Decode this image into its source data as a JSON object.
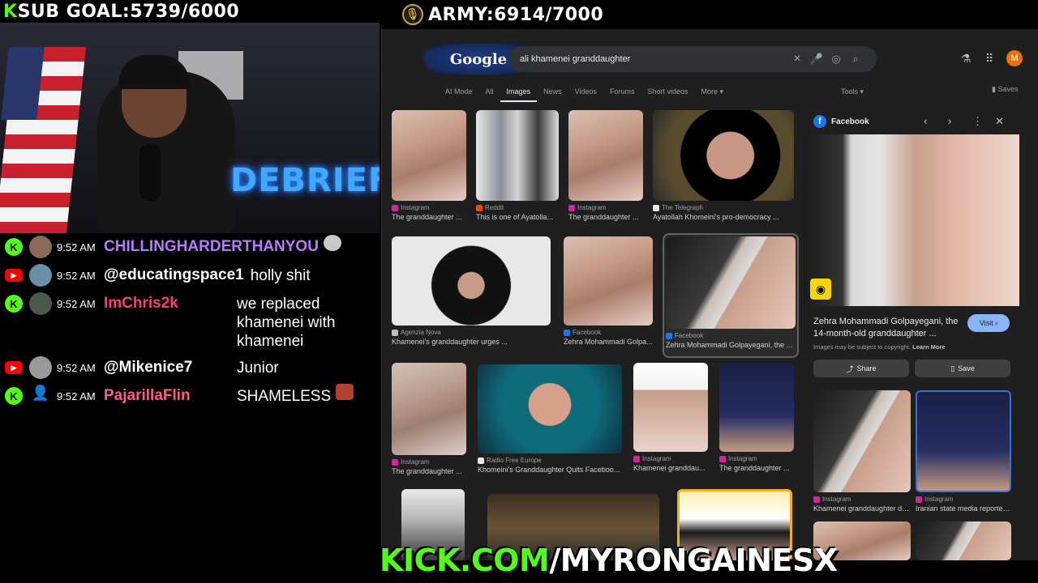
{
  "overlay": {
    "sub_goal_k": "K",
    "sub_goal": "SUB GOAL:5739/6000",
    "army_goal": "ARMY:6914/7000",
    "url_green": "KICK.COM",
    "url_white": "/MYRONGAINESX",
    "accent": "#53fc18"
  },
  "webcam": {
    "sign": "DEBRIEF"
  },
  "chat": [
    {
      "platform": "kick",
      "time": "9:52 AM",
      "user": "CHILLINGHARDERTHANYOU",
      "user_color": "#b77bff",
      "msg": ""
    },
    {
      "platform": "youtube",
      "time": "9:52 AM",
      "user": "@educatingspace1",
      "user_color": "#ffffff",
      "msg": "holly shit"
    },
    {
      "platform": "kick",
      "time": "9:52 AM",
      "user": "ImChris2k",
      "user_color": "#ff3d6e",
      "msg": "we replaced khamenei with khamenei"
    },
    {
      "platform": "youtube",
      "time": "9:52 AM",
      "user": "@Mikenice7",
      "user_color": "#ffffff",
      "msg": "Junior"
    },
    {
      "platform": "kick",
      "time": "9:52 AM",
      "user": "PajarillaFlin",
      "user_color": "#ff5a8a",
      "msg": "SHAMELESS"
    }
  ],
  "google": {
    "logo": "Google",
    "query": "ali khamenei granddaughter",
    "profile_initial": "M",
    "tabs": [
      "AI Mode",
      "All",
      "Images",
      "News",
      "Videos",
      "Forums",
      "Short videos",
      "More"
    ],
    "tools": "Tools",
    "saves": "Saves",
    "results": [
      {
        "source": "Instagram",
        "caption": "The granddaughter ..."
      },
      {
        "source": "Reddit",
        "caption": "This is one of Ayatolla..."
      },
      {
        "source": "Instagram",
        "caption": "The granddaughter ..."
      },
      {
        "source": "The Telegraph",
        "caption": "Ayatollah Khomeini's pro-democracy ..."
      },
      {
        "source": "Agenzia Nova",
        "caption": "Khamenei's granddaughter urges ..."
      },
      {
        "source": "Facebook",
        "caption": "Zehra Mohammadi Golpa..."
      },
      {
        "source": "Facebook",
        "caption": "Zehra Mohammadi Golpayegani, the ..."
      },
      {
        "source": "Instagram",
        "caption": "The granddaughter ..."
      },
      {
        "source": "Radio Free Europe",
        "caption": "Khomeini's Granddaughter Quits Faceboo..."
      },
      {
        "source": "Instagram",
        "caption": "Khamenei granddau..."
      },
      {
        "source": "Instagram",
        "caption": "The granddaughter ..."
      }
    ],
    "panel": {
      "source": "Facebook",
      "title": "Zehra Mohammadi Golpayegani, the 14-month-old granddaughter ...",
      "visit": "Visit",
      "copyright": "Images may be subject to copyright.",
      "learn_more": "Learn More",
      "share": "Share",
      "save": "Save",
      "related": [
        {
          "source": "Instagram",
          "caption": "Khamenei granddaughter dies ..."
        },
        {
          "source": "Instagram",
          "caption": "Iranian state media reported..."
        }
      ]
    }
  }
}
